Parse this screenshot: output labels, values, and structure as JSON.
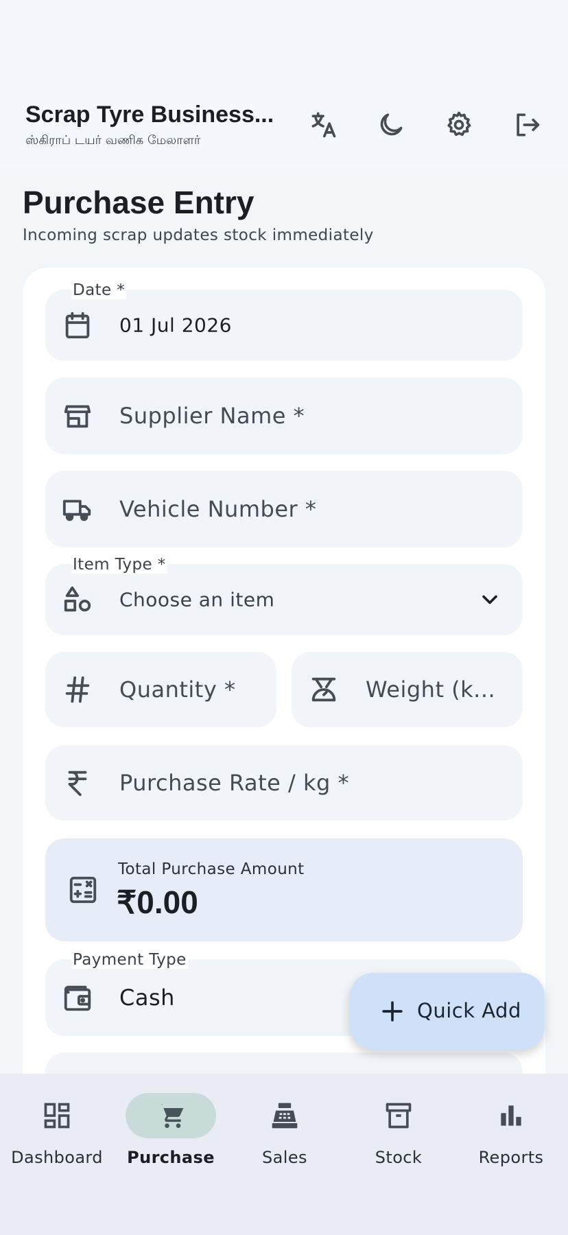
{
  "app": {
    "title": "Scrap Tyre Business...",
    "subtitle": "ஸ்கிராப் டயர் வணிக மேலாளர்"
  },
  "appbar_actions": [
    {
      "icon": "translate-icon"
    },
    {
      "icon": "dark-mode-icon"
    },
    {
      "icon": "settings-icon"
    },
    {
      "icon": "logout-icon"
    }
  ],
  "page": {
    "title": "Purchase Entry",
    "subtitle": "Incoming scrap updates stock immediately"
  },
  "form": {
    "date_label": "Date *",
    "date_value": "01 Jul 2026",
    "supplier_placeholder": "Supplier Name *",
    "vehicle_placeholder": "Vehicle Number *",
    "item_type_label": "Item Type *",
    "item_type_value": "Choose an item",
    "quantity_placeholder": "Quantity *",
    "weight_placeholder": "Weight (k...",
    "rate_placeholder": "Purchase Rate / kg *",
    "total_label": "Total Purchase Amount",
    "total_value": "₹0.00",
    "payment_label": "Payment Type",
    "payment_value": "Cash"
  },
  "fab": {
    "label": "Quick Add"
  },
  "bottom_nav": [
    {
      "label": "Dashboard",
      "icon": "dashboard-icon",
      "active": false
    },
    {
      "label": "Purchase",
      "icon": "cart-icon",
      "active": true
    },
    {
      "label": "Sales",
      "icon": "cash-register-icon",
      "active": false
    },
    {
      "label": "Stock",
      "icon": "archive-icon",
      "active": false
    },
    {
      "label": "Reports",
      "icon": "bar-chart-icon",
      "active": false
    }
  ],
  "colors": {
    "background": "#f3f6f9",
    "card": "#ffffff",
    "field": "#f1f4f8",
    "total_bg": "#e6edf9",
    "fab_bg": "#cfe1f8",
    "nav_bg": "#e9edf3",
    "nav_active_pill": "#c9dbd9",
    "icon": "#474d55"
  }
}
